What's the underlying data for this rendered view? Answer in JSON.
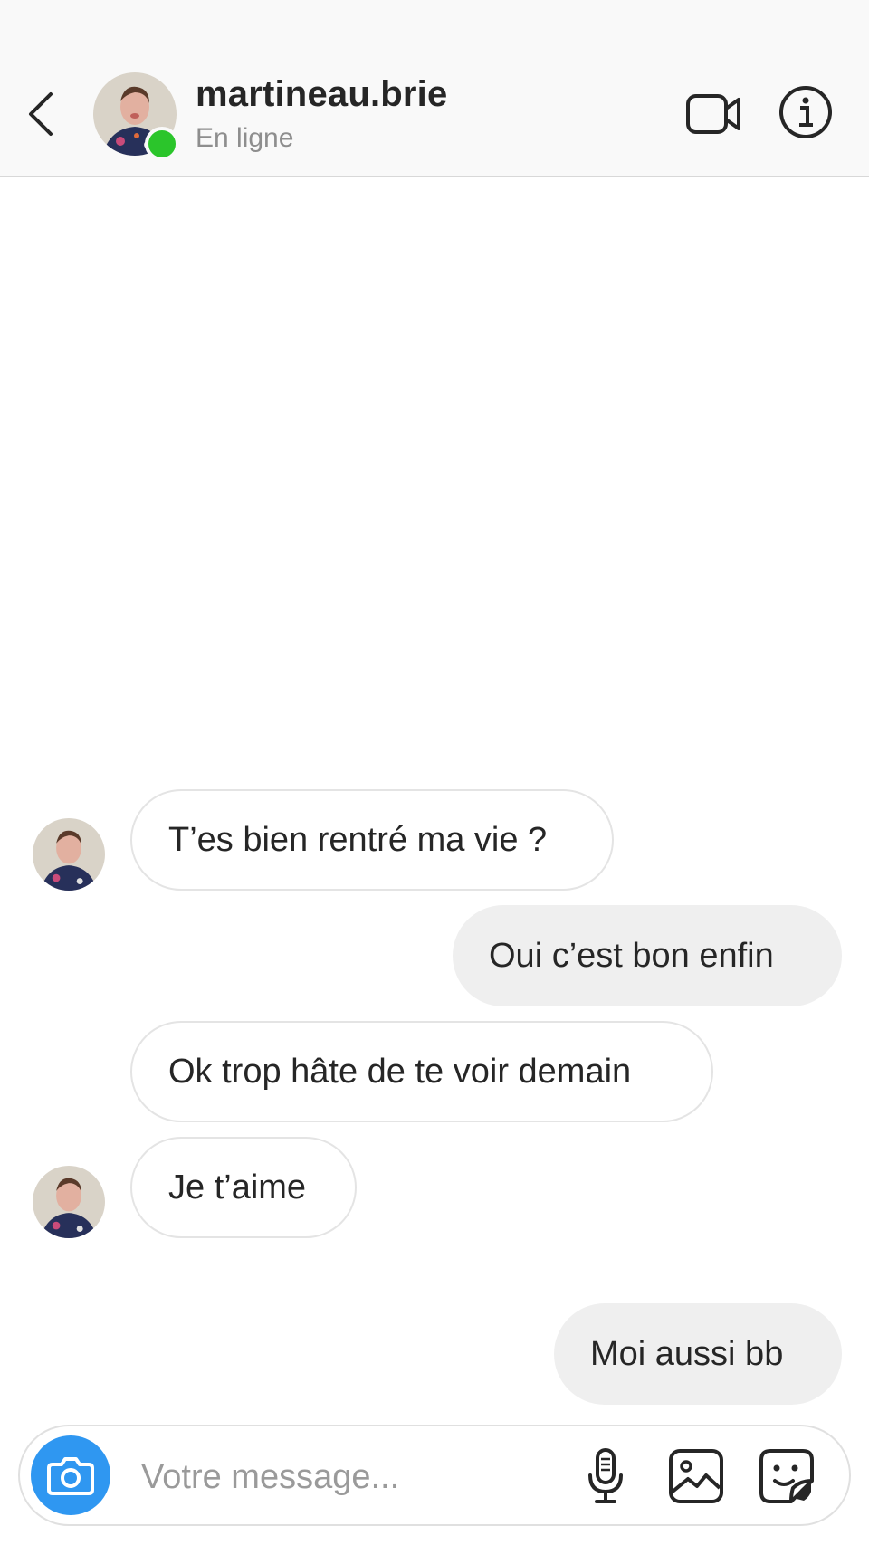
{
  "header": {
    "username": "martineau.brie",
    "status": "En ligne"
  },
  "messages": [
    {
      "direction": "in",
      "text": "T’es bien rentré ma vie ?"
    },
    {
      "direction": "out",
      "text": "Oui c’est bon enfin"
    },
    {
      "direction": "in",
      "text": "Ok trop hâte de te voir demain"
    },
    {
      "direction": "in",
      "text": "Je t’aime"
    },
    {
      "direction": "out",
      "text": "Moi aussi bb"
    }
  ],
  "composer": {
    "placeholder": "Votre message..."
  },
  "colors": {
    "online": "#2bc52b",
    "camera_button": "#2f97f1",
    "outgoing_bubble": "#efefef",
    "incoming_border": "#e4e4e4"
  },
  "icons": [
    "back-chevron-icon",
    "video-call-icon",
    "info-icon",
    "camera-icon",
    "microphone-icon",
    "gallery-icon",
    "sticker-icon"
  ]
}
